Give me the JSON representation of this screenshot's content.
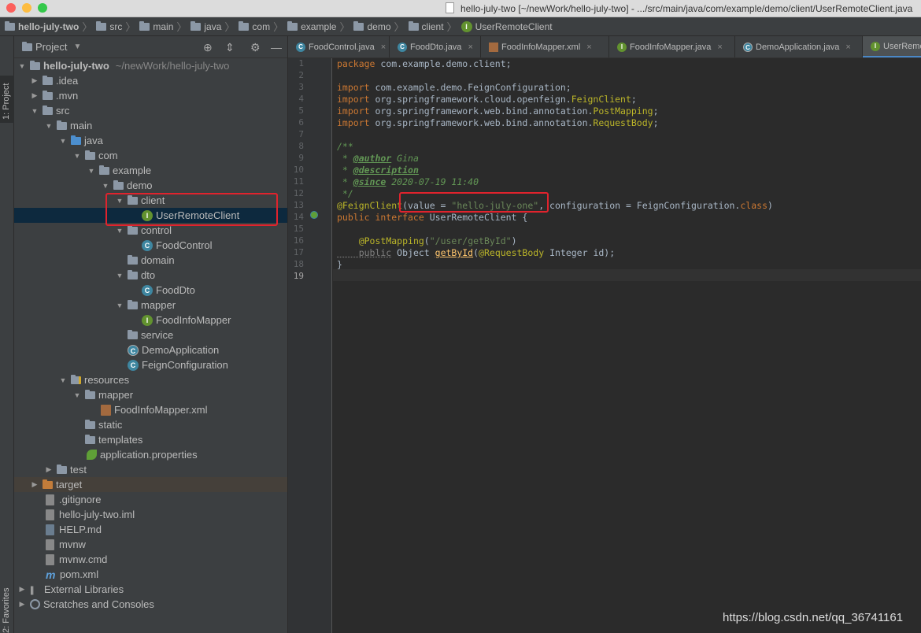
{
  "window": {
    "title": "hello-july-two [~/newWork/hello-july-two] - .../src/main/java/com/example/demo/client/UserRemoteClient.java"
  },
  "breadcrumbs": [
    "hello-july-two",
    "src",
    "main",
    "java",
    "com",
    "example",
    "demo",
    "client",
    "UserRemoteClient"
  ],
  "left_stripe": {
    "project_label": "1: Project",
    "favorites_label": "2: Favorites"
  },
  "project_panel": {
    "title": "Project",
    "tree": [
      {
        "label": "hello-july-two",
        "extra": "~/newWork/hello-july-two",
        "icon": "folder-icon"
      },
      {
        "label": ".idea",
        "icon": "folder-icon"
      },
      {
        "label": ".mvn",
        "icon": "folder-icon"
      },
      {
        "label": "src",
        "icon": "folder-icon"
      },
      {
        "label": "main",
        "icon": "folder-icon"
      },
      {
        "label": "java",
        "icon": "source-folder-icon"
      },
      {
        "label": "com",
        "icon": "package-icon"
      },
      {
        "label": "example",
        "icon": "package-icon"
      },
      {
        "label": "demo",
        "icon": "package-icon"
      },
      {
        "label": "client",
        "icon": "package-icon"
      },
      {
        "label": "UserRemoteClient",
        "icon": "interface-icon"
      },
      {
        "label": "control",
        "icon": "package-icon"
      },
      {
        "label": "FoodControl",
        "icon": "class-icon"
      },
      {
        "label": "domain",
        "icon": "package-icon"
      },
      {
        "label": "dto",
        "icon": "package-icon"
      },
      {
        "label": "FoodDto",
        "icon": "class-icon"
      },
      {
        "label": "mapper",
        "icon": "package-icon"
      },
      {
        "label": "FoodInfoMapper",
        "icon": "interface-icon"
      },
      {
        "label": "service",
        "icon": "package-icon"
      },
      {
        "label": "DemoApplication",
        "icon": "spring-class-icon"
      },
      {
        "label": "FeignConfiguration",
        "icon": "class-icon"
      },
      {
        "label": "resources",
        "icon": "resources-folder-icon"
      },
      {
        "label": "mapper",
        "icon": "folder-icon"
      },
      {
        "label": "FoodInfoMapper.xml",
        "icon": "xml-file-icon"
      },
      {
        "label": "static",
        "icon": "folder-icon"
      },
      {
        "label": "templates",
        "icon": "folder-icon"
      },
      {
        "label": "application.properties",
        "icon": "spring-properties-icon"
      },
      {
        "label": "test",
        "icon": "folder-icon"
      },
      {
        "label": "target",
        "icon": "excluded-folder-icon"
      },
      {
        "label": ".gitignore",
        "icon": "file-icon"
      },
      {
        "label": "hello-july-two.iml",
        "icon": "file-icon"
      },
      {
        "label": "HELP.md",
        "icon": "markdown-file-icon"
      },
      {
        "label": "mvnw",
        "icon": "file-icon"
      },
      {
        "label": "mvnw.cmd",
        "icon": "file-icon"
      },
      {
        "label": "pom.xml",
        "icon": "maven-icon"
      },
      {
        "label": "External Libraries",
        "icon": "libraries-icon"
      },
      {
        "label": "Scratches and Consoles",
        "icon": "scratches-icon"
      }
    ]
  },
  "tabs": [
    {
      "label": "FoodControl.java",
      "close": "×"
    },
    {
      "label": "FoodDto.java",
      "close": "×"
    },
    {
      "label": "FoodInfoMapper.xml",
      "close": "×"
    },
    {
      "label": "FoodInfoMapper.java",
      "close": "×"
    },
    {
      "label": "DemoApplication.java",
      "close": "×"
    },
    {
      "label": "UserRemoteClient.java"
    }
  ],
  "editor": {
    "lines": {
      "l1a": "package",
      "l1b": " com.example.demo.client;",
      "l3a": "import",
      "l3b": " com.example.demo.FeignConfiguration;",
      "l4a": "import",
      "l4b": " org.springframework.cloud.openfeign.",
      "l4c": "FeignClient",
      "l4d": ";",
      "l5a": "import",
      "l5b": " org.springframework.web.bind.annotation.",
      "l5c": "PostMapping",
      "l5d": ";",
      "l6a": "import",
      "l6b": " org.springframework.web.bind.annotation.",
      "l6c": "RequestBody",
      "l6d": ";",
      "l8": "/**",
      "l9a": " * ",
      "l9b": "@author",
      "l9c": " Gina",
      "l10a": " * ",
      "l10b": "@description",
      "l11a": " * ",
      "l11b": "@since",
      "l11c": " 2020-07-19 11:40",
      "l12": " */",
      "l13a": "@FeignClient",
      "l13b": "(value = ",
      "l13c": "\"hello-july-one\"",
      "l13d": ", configuration = FeignConfiguration.",
      "l13e": "class",
      "l13f": ")",
      "l14a": "public interface",
      "l14b": " UserRemoteClient {",
      "l16a": "    ",
      "l16b": "@PostMapping",
      "l16c": "(",
      "l16d": "\"/user/getById\"",
      "l16e": ")",
      "l17a": "    public",
      "l17b": " Object ",
      "l17c": "getById",
      "l17d": "(",
      "l17e": "@RequestBody",
      "l17f": " Integer id);",
      "l18": "}"
    }
  },
  "watermark": "https://blog.csdn.net/qq_36741161",
  "colors": {
    "selection": "#0d293e",
    "highlight_box": "#e0232d"
  }
}
